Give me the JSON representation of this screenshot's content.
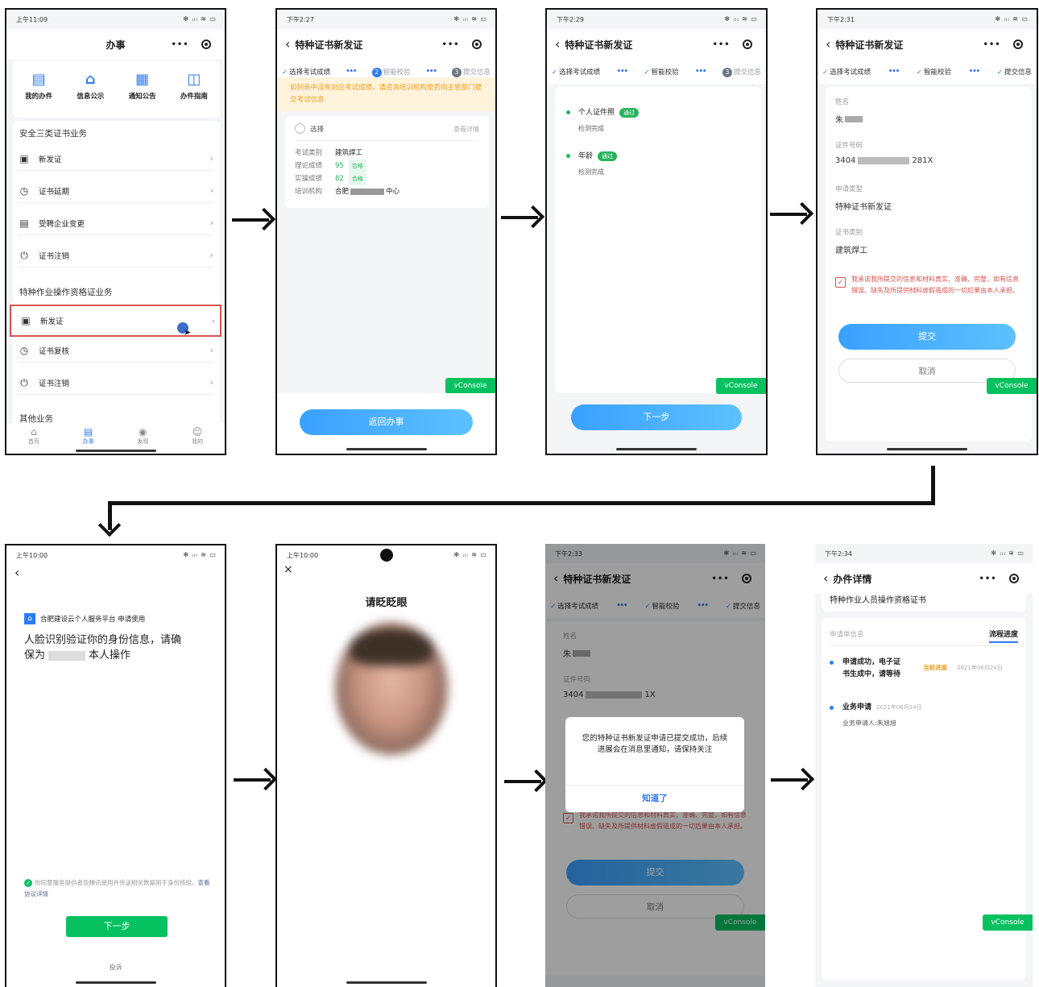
{
  "screen1": {
    "time": "上午11:09",
    "status": "✻ ᵢₗₗ ≋ ▭",
    "title": "办事",
    "quick": [
      "我的办件",
      "信息公示",
      "通知公告",
      "办件指南"
    ],
    "section1": "安全三类证书业务",
    "rows1": [
      "新发证",
      "证书延期",
      "受聘企业变更",
      "证书注销"
    ],
    "section2": "特种作业操作资格证业务",
    "rows2": [
      "新发证",
      "证书复核",
      "证书注销"
    ],
    "section3": "其他业务",
    "tabs": [
      "首页",
      "办事",
      "发现",
      "我的"
    ]
  },
  "screen2": {
    "time": "下午2:27",
    "title": "特种证书新发证",
    "steps": [
      "选择考试成绩",
      "智能校验",
      "提交信息"
    ],
    "step2_num": "2",
    "step3_num": "3",
    "notice": "如列表中没有对应考试成绩，请咨询培训机构是否向主管部门提交考试信息",
    "select_label": "选择",
    "detail_link": "查看详情",
    "fields": [
      {
        "k": "考试类别",
        "v": "建筑焊工",
        "tag": ""
      },
      {
        "k": "理论成绩",
        "v": "95",
        "tag": "合格"
      },
      {
        "k": "实操成绩",
        "v": "82",
        "tag": "合格"
      },
      {
        "k": "培训机构",
        "v": "合肥",
        "tag": "",
        "suffix": "中心"
      }
    ],
    "vconsole": "vConsole",
    "button": "返回办事"
  },
  "screen3": {
    "time": "下午2:29",
    "title": "特种证书新发证",
    "steps": [
      "选择考试成绩",
      "智能校验",
      "提交信息"
    ],
    "step3_num": "3",
    "checks": [
      {
        "name": "个人证件照",
        "badge": "通过",
        "sub": "检测完成"
      },
      {
        "name": "年龄",
        "badge": "通过",
        "sub": "检测完成"
      }
    ],
    "vconsole": "vConsole",
    "button": "下一步"
  },
  "screen4": {
    "time": "下午2:31",
    "title": "特种证书新发证",
    "steps": [
      "选择考试成绩",
      "智能校验",
      "提交信息"
    ],
    "fields": [
      {
        "k": "姓名",
        "v": "朱"
      },
      {
        "k": "证件号码",
        "v": "3404",
        "v2": "281X"
      },
      {
        "k": "申请类型",
        "v": "特种证书新发证"
      },
      {
        "k": "证书类别",
        "v": "建筑焊工"
      }
    ],
    "promise": "我承诺我所提交的信息和材料真实、准确、完整，如有信息错误、缺失及所提供材料虚假造成的一切后果由本人承担。",
    "submit": "提交",
    "cancel": "取消",
    "vconsole": "vConsole"
  },
  "screen5": {
    "time": "上午10:00",
    "platform": "合肥建设云个人服务平台 申请使用",
    "heading_a": "人脸识别验证你的身份信息，请确",
    "heading_b": "保为",
    "heading_c": "本人操作",
    "agree": "你同意服务提供者及腾讯使用并传送相关数据用于身份核验。",
    "agree_link": "查看协议详情",
    "next": "下一步",
    "complain": "投诉"
  },
  "screen6": {
    "time": "上午10:00",
    "title": "请眨眨眼",
    "close": "×"
  },
  "screen7": {
    "time": "下午2:33",
    "title": "特种证书新发证",
    "steps": [
      "选择考试成绩",
      "智能校验",
      "提交信息"
    ],
    "fields": [
      {
        "k": "姓名",
        "v": "朱"
      },
      {
        "k": "证件号码",
        "v": "3404",
        "v2": "1X"
      }
    ],
    "dialog": "您的特种证书新发证申请已提交成功，后续进展会在消息里通知，请保持关注",
    "dialog_btn": "知道了",
    "promise": "我承诺我所提交的信息和材料真实、准确、完整，如有信息错误、缺失及所提供材料虚假造成的一切后果由本人承担。",
    "submit": "提交",
    "cancel": "取消",
    "vconsole": "vConsole"
  },
  "screen8": {
    "time": "下午2:34",
    "title": "办件详情",
    "card_title": "特种作业人员操作资格证书",
    "tab1": "申请单信息",
    "tab2": "流程进度",
    "items": [
      {
        "t1": "申请成功，电子证",
        "t2": "书生成中，请等待",
        "tag": "当前进度",
        "date": "2021年06月24日"
      },
      {
        "t1": "业务申请",
        "date": "2021年06月24日",
        "sub": "业务申请人:朱旭旭"
      }
    ],
    "vconsole": "vConsole"
  },
  "colors": {
    "accent": "#2d7bf4",
    "green": "#07c160",
    "button": "#3aa0ff",
    "notice_bg": "#fff3dc",
    "notice_text": "#f0a020"
  }
}
